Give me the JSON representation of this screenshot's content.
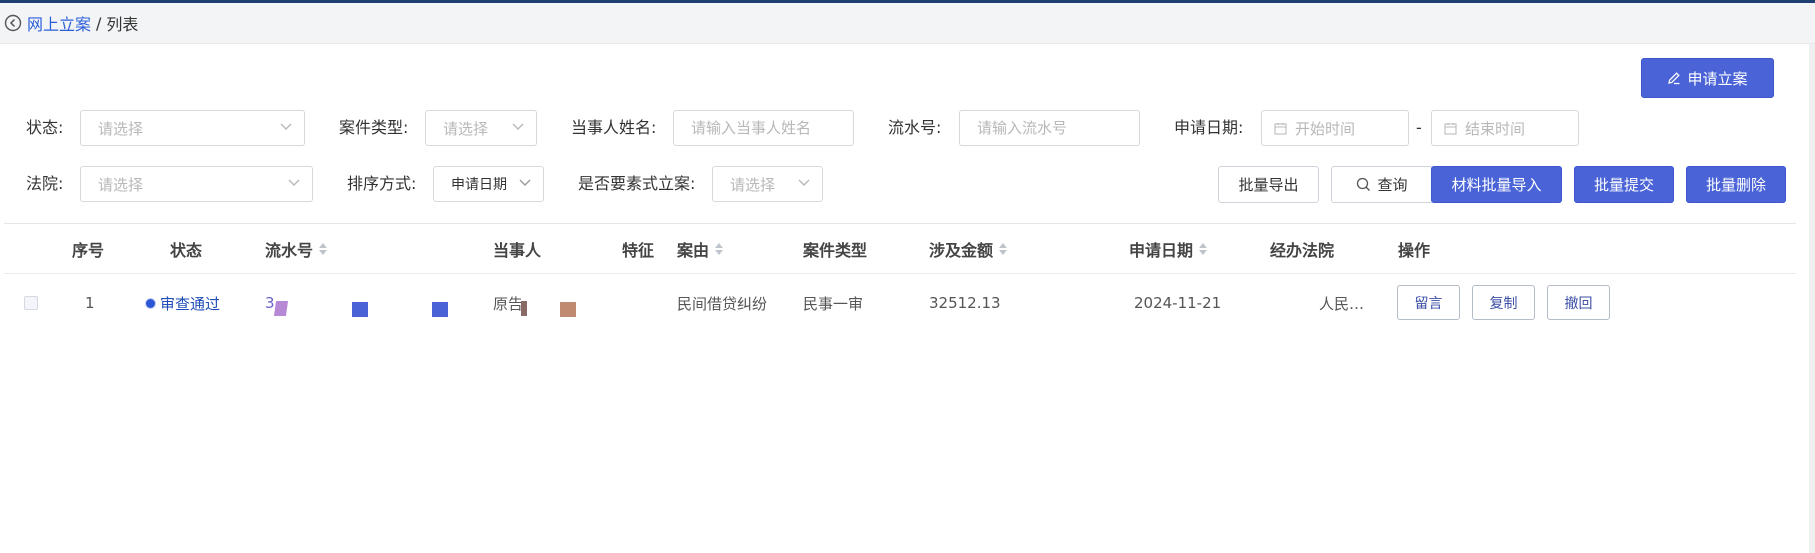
{
  "breadcrumb": {
    "parent": "网上立案",
    "separator": "/",
    "current": "列表"
  },
  "actions": {
    "apply_case": "申请立案"
  },
  "filters": {
    "status": {
      "label": "状态:",
      "placeholder": "请选择"
    },
    "case_type": {
      "label": "案件类型:",
      "placeholder": "请选择"
    },
    "party_name": {
      "label": "当事人姓名:",
      "placeholder": "请输入当事人姓名"
    },
    "serial_no": {
      "label": "流水号:",
      "placeholder": "请输入流水号"
    },
    "apply_date": {
      "label": "申请日期:",
      "start_placeholder": "开始时间",
      "separator": "-",
      "end_placeholder": "结束时间"
    },
    "court": {
      "label": "法院:",
      "placeholder": "请选择"
    },
    "sort_by": {
      "label": "排序方式:",
      "value": "申请日期"
    },
    "element_style": {
      "label": "是否要素式立案:",
      "placeholder": "请选择"
    }
  },
  "toolbar": {
    "batch_export": "批量导出",
    "query": "查询",
    "material_import": "材料批量导入",
    "batch_submit": "批量提交",
    "batch_delete": "批量删除"
  },
  "table": {
    "columns": {
      "index": "序号",
      "status": "状态",
      "serial": "流水号",
      "party": "当事人",
      "feature": "特征",
      "cause": "案由",
      "case_type": "案件类型",
      "amount": "涉及金额",
      "apply_date": "申请日期",
      "court": "经办法院",
      "ops": "操作"
    },
    "rows": [
      {
        "index": "1",
        "status": "审查通过",
        "serial": "3",
        "party": "原告",
        "cause": "民间借贷纠纷",
        "case_type": "民事一审",
        "amount": "32512.13",
        "apply_date": "2024-11-21",
        "court": "人民…",
        "ops": {
          "message": "留言",
          "copy": "复制",
          "withdraw": "撤回"
        }
      }
    ]
  },
  "colors": {
    "primary": "#4a64d8",
    "link": "#2b5fd9",
    "status_dot": "#2b57d6",
    "header_bar": "#1d3f72"
  }
}
